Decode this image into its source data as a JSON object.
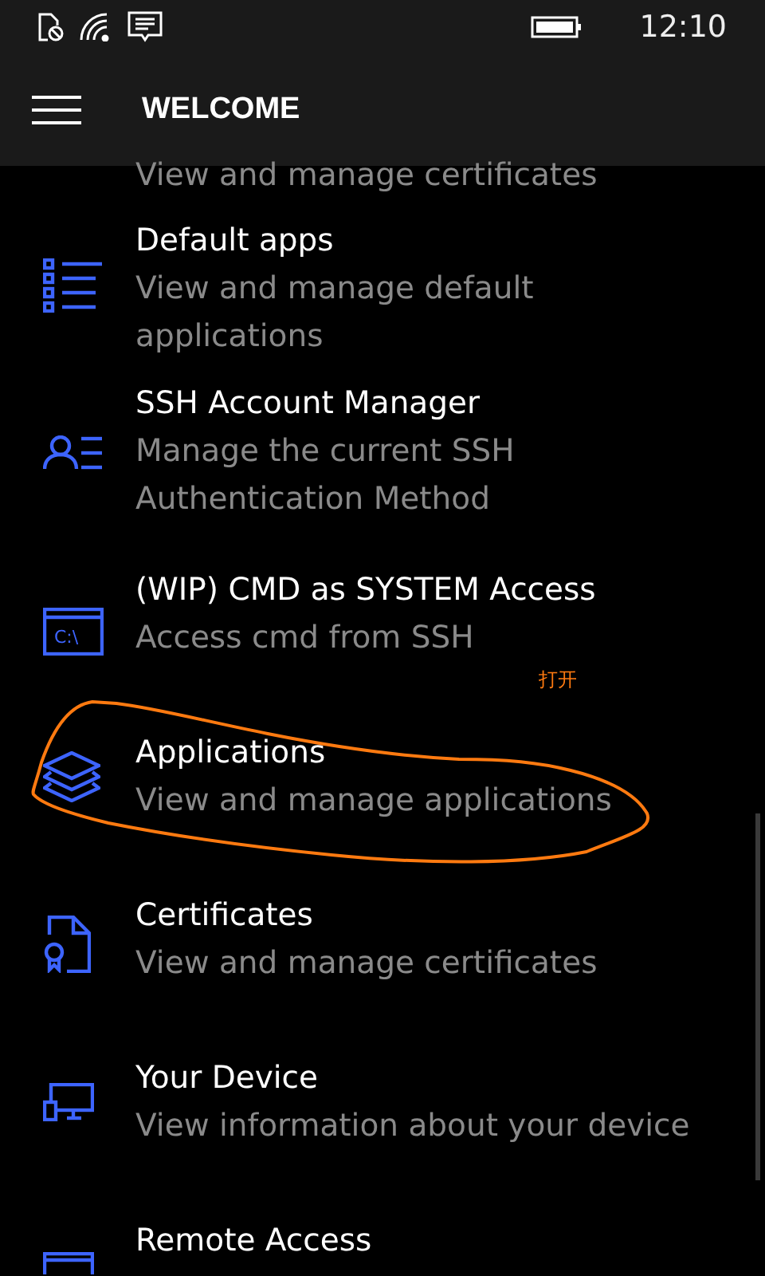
{
  "status_bar": {
    "time": "12:10"
  },
  "header": {
    "title": "WELCOME"
  },
  "partial_item": {
    "subtitle": "View and manage certificates"
  },
  "items": [
    {
      "kind": "list",
      "title": "Default apps",
      "subtitle": "View and manage default applications",
      "highlighted": false
    },
    {
      "kind": "account",
      "title": "SSH Account Manager",
      "subtitle": "Manage the current SSH Authentication Method",
      "highlighted": false
    },
    {
      "kind": "console",
      "icon_label": "C:\\",
      "title": "(WIP) CMD as SYSTEM Access",
      "subtitle": "Access cmd from SSH",
      "highlighted": false
    },
    {
      "kind": "layers",
      "title": "Applications",
      "subtitle": "View and manage applications",
      "highlighted": true
    },
    {
      "kind": "certificate",
      "title": "Certificates",
      "subtitle": "View and manage certificates",
      "highlighted": false
    },
    {
      "kind": "device",
      "title": "Your Device",
      "subtitle": "View information about your device",
      "highlighted": false
    },
    {
      "kind": "remote",
      "title": "Remote Access",
      "highlighted": false
    }
  ],
  "annotation": {
    "note": "打开"
  }
}
